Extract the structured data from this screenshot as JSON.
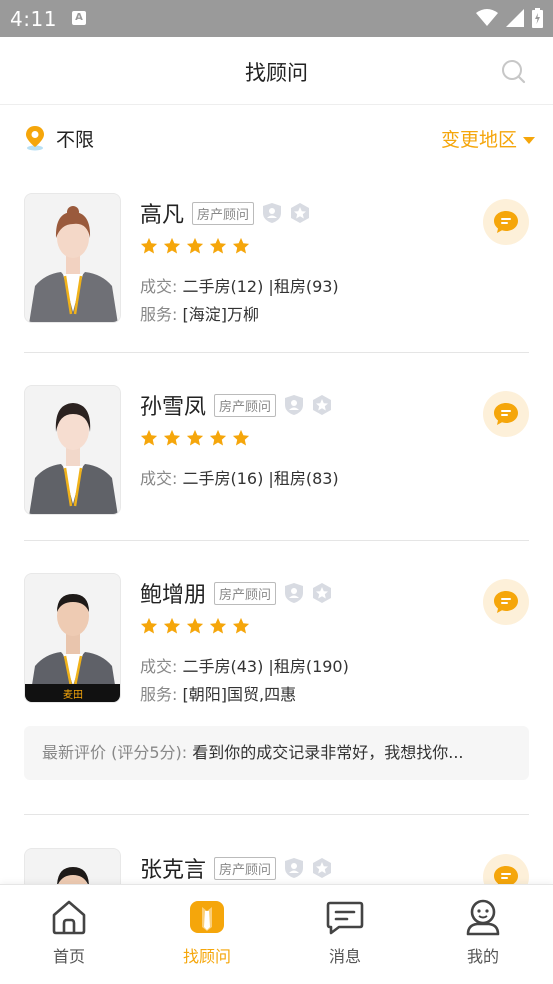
{
  "status_bar": {
    "time": "4:11",
    "notification_letter": "A"
  },
  "header": {
    "title": "找顾问"
  },
  "location": {
    "current": "不限",
    "change_label": "变更地区"
  },
  "agents": [
    {
      "name": "高凡",
      "role": "房产顾问",
      "stars": 5,
      "deals_key": "成交:",
      "deals_value": "二手房(12) |租房(93)",
      "service_key": "服务:",
      "service_value": "[海淀]万柳"
    },
    {
      "name": "孙雪凤",
      "role": "房产顾问",
      "stars": 5,
      "deals_key": "成交:",
      "deals_value": "二手房(16) |租房(83)"
    },
    {
      "name": "鲍增朋",
      "role": "房产顾问",
      "stars": 5,
      "deals_key": "成交:",
      "deals_value": "二手房(43) |租房(190)",
      "service_key": "服务:",
      "service_value": "[朝阳]国贸,四惠",
      "review_key": "最新评价 (评分5分):",
      "review_text": "看到你的成交记录非常好，我想找你..."
    },
    {
      "name": "张克言",
      "role": "房产顾问"
    }
  ],
  "tabbar": [
    {
      "label": "首页",
      "icon": "home-icon",
      "active": false
    },
    {
      "label": "找顾问",
      "icon": "find-advisor-icon",
      "active": true
    },
    {
      "label": "消息",
      "icon": "message-icon",
      "active": false
    },
    {
      "label": "我的",
      "icon": "profile-icon",
      "active": false
    }
  ],
  "colors": {
    "accent": "#f5a60b",
    "chat_bg": "#fdf0d9",
    "status_bar": "#9a9a9a"
  }
}
